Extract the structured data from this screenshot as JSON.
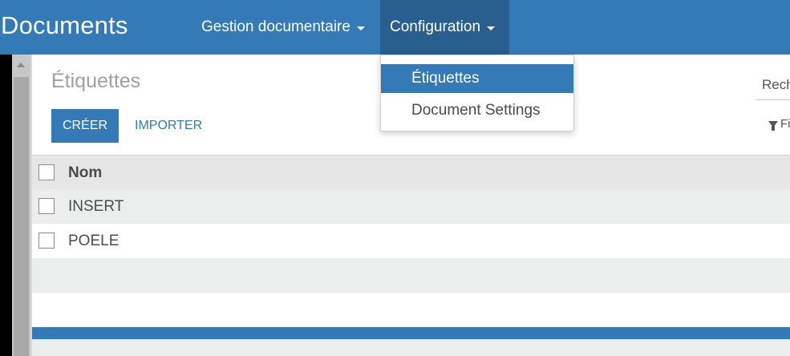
{
  "app": {
    "title": "Documents"
  },
  "nav": [
    {
      "label": "Gestion documentaire"
    },
    {
      "label": "Configuration"
    }
  ],
  "dropdown": {
    "items": [
      {
        "label": "Étiquettes",
        "selected": true
      },
      {
        "label": "Document Settings",
        "selected": false
      }
    ]
  },
  "page": {
    "title": "Étiquettes"
  },
  "buttons": {
    "create": "CRÉER",
    "import": "IMPORTER"
  },
  "search": {
    "placeholder": "Recherche"
  },
  "filter": {
    "label": "Filtres"
  },
  "table": {
    "header": "Nom",
    "rows": [
      {
        "name": "INSERT"
      },
      {
        "name": "POELE"
      }
    ]
  },
  "colors": {
    "primary": "#337ab7",
    "active_nav": "#285f8f"
  }
}
